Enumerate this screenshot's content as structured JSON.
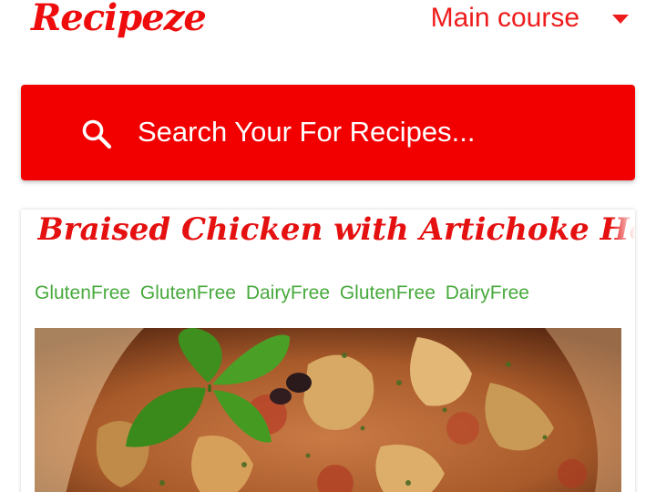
{
  "header": {
    "brand": "Recipeze",
    "category": "Main course"
  },
  "search": {
    "placeholder": "Search Your For Recipes..."
  },
  "recipe": {
    "title": "Braised Chicken with Artichoke Hearts",
    "tags": [
      "GlutenFree",
      "GlutenFree",
      "DairyFree",
      "GlutenFree",
      "DairyFree"
    ]
  },
  "colors": {
    "brand_red": "#f20000",
    "tag_green": "#47a93c"
  },
  "icons": {
    "search": "search-icon",
    "dropdown": "chevron-down-icon"
  }
}
